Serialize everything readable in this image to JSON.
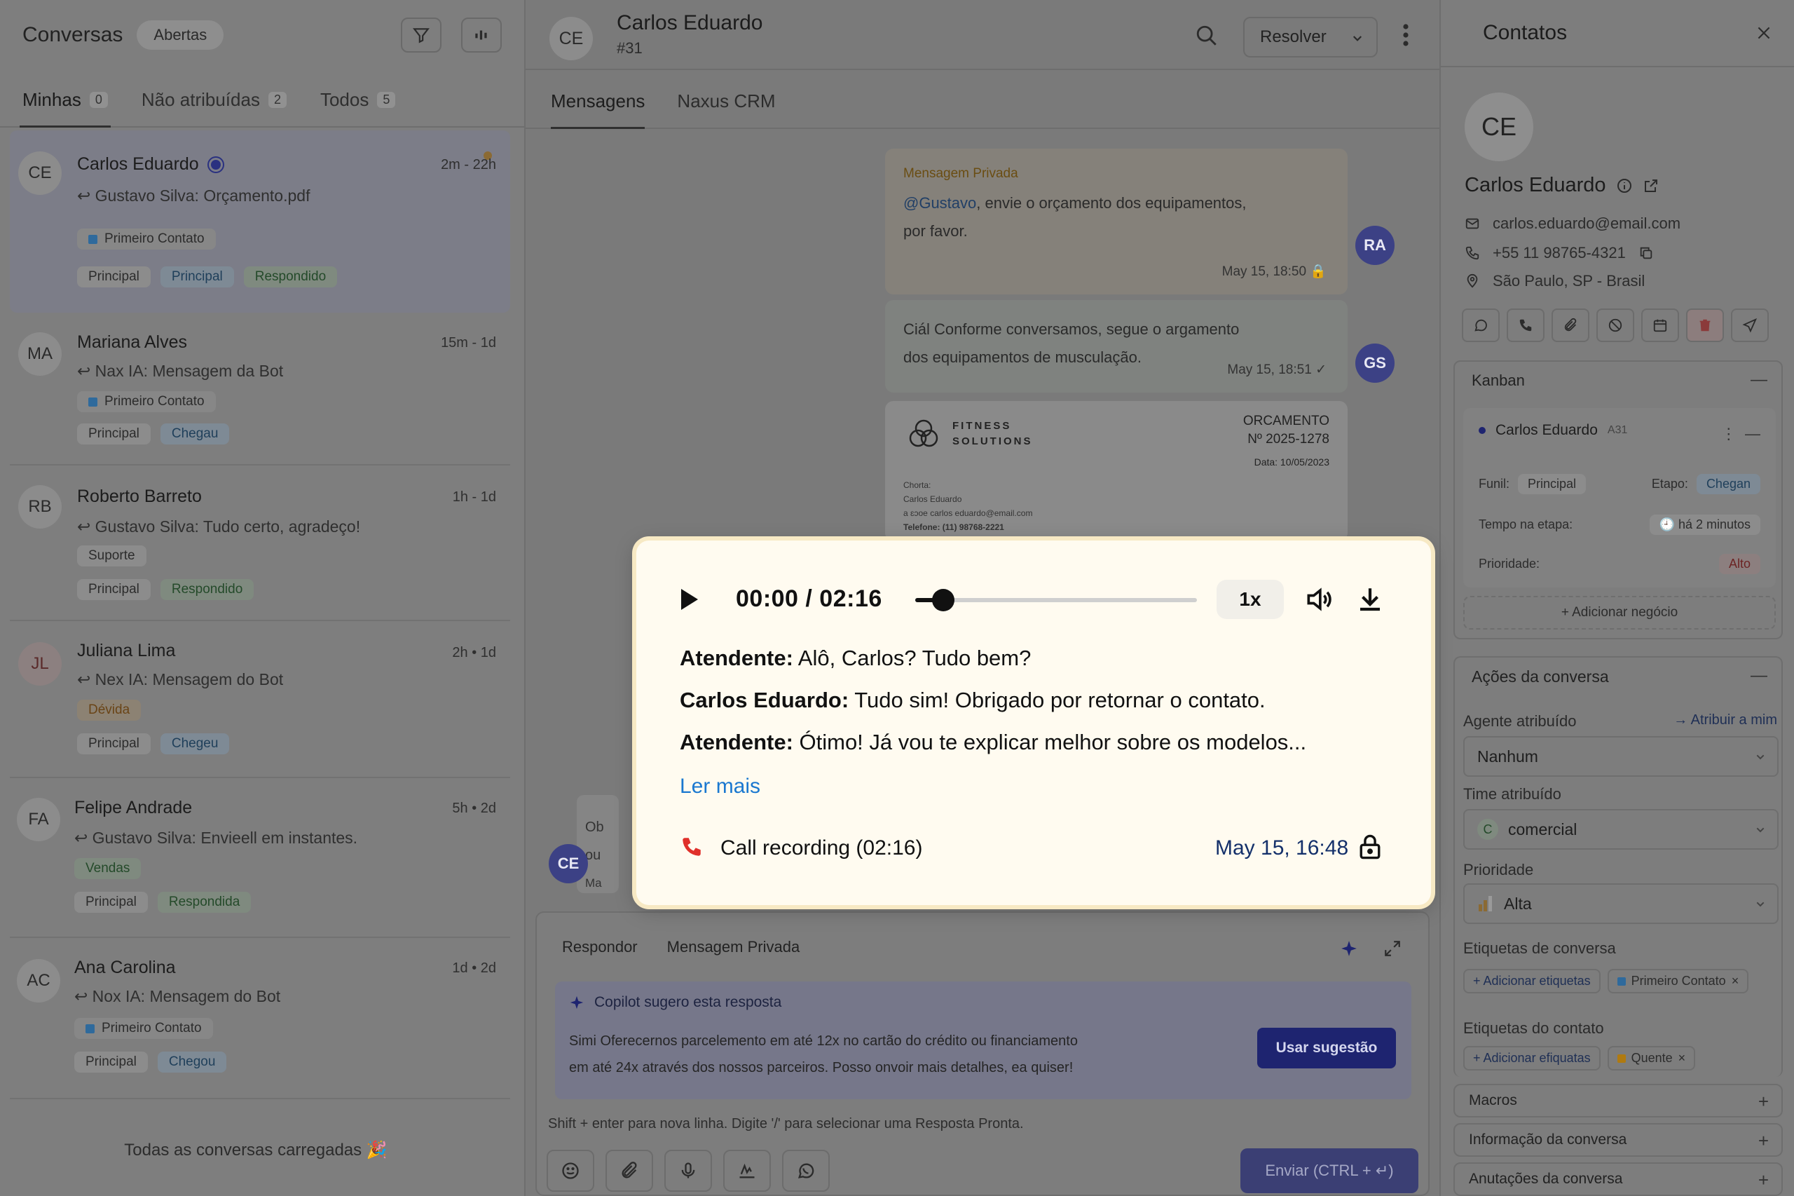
{
  "left": {
    "title": "Conversas",
    "status_pill": "Abertas",
    "tabs": [
      {
        "label": "Minhas",
        "count": "0"
      },
      {
        "label": "Não atribuídas",
        "count": "2"
      },
      {
        "label": "Todos",
        "count": "5"
      }
    ],
    "conversations": [
      {
        "initials": "CE",
        "name": "Carlos Eduardo",
        "time": "2m - 22h",
        "preview": "↩ Gustavo Silva: Orçamento.pdf",
        "label": "Primeiro Contato",
        "tags": [
          "Principal",
          "Principal",
          "Respondido"
        ]
      },
      {
        "initials": "MA",
        "name": "Mariana Alves",
        "time": "15m - 1d",
        "preview": "↩ Nax IA: Mensagem da Bot",
        "label": "Primeiro Contato",
        "tags": [
          "Principal",
          "Chegau"
        ]
      },
      {
        "initials": "RB",
        "name": "Roberto Barreto",
        "time": "1h - 1d",
        "preview": "↩ Gustavo Silva: Tudo certo, agradeço!",
        "label": "Suporte",
        "tags": [
          "Principal",
          "Respondido"
        ]
      },
      {
        "initials": "JL",
        "name": "Juliana Lima",
        "time": "2h • 1d",
        "preview": "↩ Nex IA: Mensagem do Bot",
        "label": "Dévida",
        "tags": [
          "Principal",
          "Chegeu"
        ]
      },
      {
        "initials": "FA",
        "name": "Felipe Andrade",
        "time": "5h • 2d",
        "preview": "↩ Gustavo Silva: Envieell em instantes.",
        "label": "Vendas",
        "tags": [
          "Principal",
          "Respondida"
        ]
      },
      {
        "initials": "AC",
        "name": "Ana Carolina",
        "time": "1d • 2d",
        "preview": "↩ Nox IA: Mensagem do Bot",
        "label": "Primeiro Contato",
        "tags": [
          "Principal",
          "Chegou"
        ]
      }
    ],
    "footer": "Todas as conversas carregadas 🎉"
  },
  "mid": {
    "initials": "CE",
    "name": "Carlos Eduardo",
    "id": "#31",
    "resolve": "Resolver",
    "tabs": [
      "Mensagens",
      "Naxus CRM"
    ],
    "private_label": "Mensagem Privada",
    "private_mention": "@Gustavo",
    "private_text_1": ", envie o orçamento dos equipamentos,",
    "private_text_2": "por favor.",
    "private_stamp": "May 15, 18:50",
    "private_avatar": "RA",
    "out_line_1": "Ciál Conforme conversamos, segue o argamento",
    "out_line_2": "dos equipamentos de musculação.",
    "out_stamp": "May 15, 18:51",
    "out_avatar": "GS",
    "doc_brand_1": "FITNESS",
    "doc_brand_2": "SOLUTIONS",
    "doc_q_1": "ORCAMENTO",
    "doc_q_2": "Nº 2025-1278",
    "doc_date": "Data: 10/05/2023",
    "doc_info_1": "Chorta:",
    "doc_info_2": "Carlos Eduardo",
    "doc_info_3": "a ɛɔoe carlos eduardo@email.com",
    "doc_info_4": "Telefone: (11) 98768-2221",
    "ghost_1": "Ob",
    "ghost_2": "ou",
    "ghost_3": "Ma",
    "contact_avatar": "CE",
    "composer": {
      "tab_reply": "Respondor",
      "tab_private": "Mensagem Privada",
      "copilot_title": "Copilot sugero esta resposta",
      "copilot_line_1": "Simi Oferecernos parcelemento em até 12x no cartão do crédito ou financiamento",
      "copilot_line_2": "em até 24x através dos nossos parceiros. Posso onvoir mais detalhes, ea quiser!",
      "use_button": "Usar sugestão",
      "hint": "Shift + enter para nova linha. Digite '/' para selecionar uma Resposta Pronta.",
      "send": "Enviar (CTRL + ↵)"
    }
  },
  "right": {
    "title": "Contatos",
    "initials": "CE",
    "name": "Carlos Eduardo",
    "email": "carlos.eduardo@email.com",
    "phone": "+55 11 98765-4321",
    "location": "São Paulo, SP - Brasil",
    "kanban": {
      "title": "Kanban",
      "card_name": "Carlos Eduardo",
      "card_id": "A31",
      "funnel_label": "Funil:",
      "funnel_value": "Principal",
      "stage_label": "Etapo:",
      "stage_value": "Chegan",
      "time_label": "Tempo na etapa:",
      "time_value": "há 2 minutos",
      "priority_label": "Prioridade:",
      "priority_value": "Alto",
      "add_deal": "+ Adicionar negócio"
    },
    "actions": {
      "title": "Ações da conversa",
      "agent_label": "Agente atribuído",
      "assign_me": "→ Atribuir a mim",
      "agent_value": "Nanhum",
      "team_label": "Time atribuído",
      "team_initial": "C",
      "team_value": "comercial",
      "priority_label": "Prioridade",
      "priority_value": "Alta",
      "conv_labels_title": "Etiquetas de conversa",
      "add_labels": "+ Adicionar etiquetas",
      "conv_label": "Primeiro Contato",
      "contact_labels_title": "Etiquetas do contato",
      "add_labels_2": "+ Adicionar efiquatas",
      "contact_label": "Quente"
    },
    "sections": [
      "Macros",
      "Informação da conversa",
      "Anutações da conversa"
    ]
  },
  "audio": {
    "time": "00:00 / 02:16",
    "progress": 0.1,
    "speed": "1x",
    "lines": [
      {
        "speaker": "Atendente:",
        "text": " Alô, Carlos? Tudo bem?"
      },
      {
        "speaker": "Carlos Eduardo:",
        "text": " Tudo sim! Obrigado por retornar o contato."
      },
      {
        "speaker": "Atendente:",
        "text": " Ótimo! Já vou te explicar melhor sobre os modelos..."
      }
    ],
    "read_more": "Ler mais",
    "recording": "Call recording (02:16)",
    "date": "May 15, 16:48"
  },
  "colors": {
    "accent": "#1e2470",
    "link": "#1a78d0",
    "phone_red": "#e0302a"
  }
}
